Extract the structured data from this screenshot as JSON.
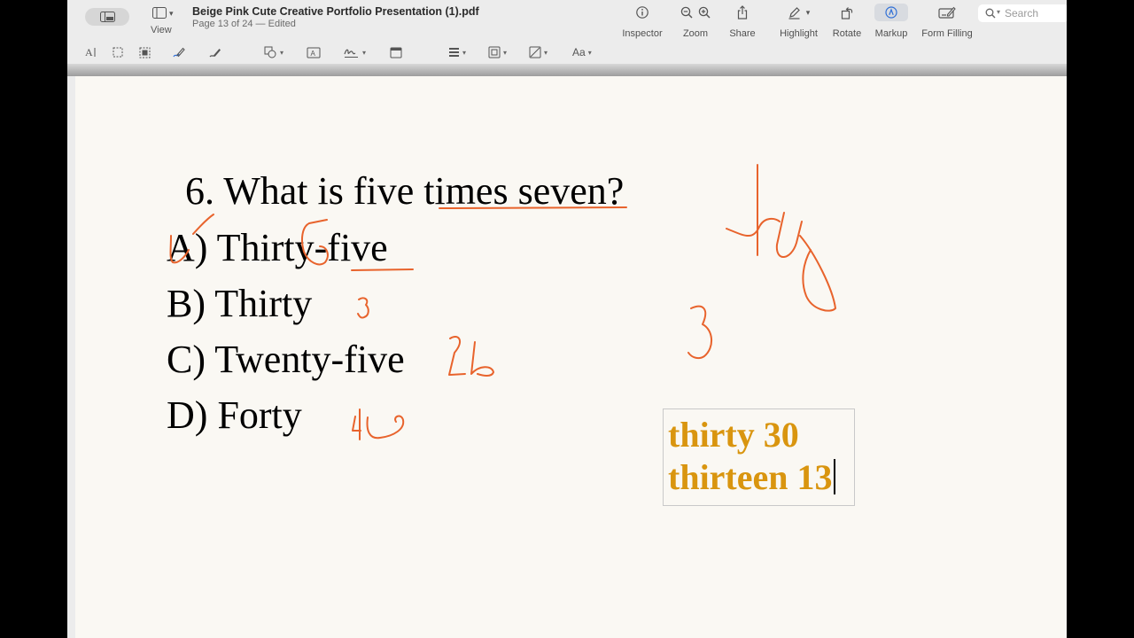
{
  "window": {
    "title": "Beige Pink Cute Creative Portfolio Presentation (1).pdf",
    "subtitle": "Page 13 of 24 — Edited"
  },
  "toolbar": {
    "view_label": "View",
    "inspector_label": "Inspector",
    "zoom_label": "Zoom",
    "share_label": "Share",
    "highlight_label": "Highlight",
    "rotate_label": "Rotate",
    "markup_label": "Markup",
    "form_filling_label": "Form Filling",
    "search_placeholder": "Search",
    "accent_color": "#2f6fd6"
  },
  "markup_bar": {
    "font_style_label": "Aa",
    "tools": [
      "text-selection-icon",
      "rect-selection-icon",
      "instant-alpha-icon",
      "sketch-icon",
      "draw-icon",
      "shapes-icon",
      "text-box-icon",
      "signature-icon",
      "note-icon",
      "shape-style-icon",
      "border-color-icon",
      "fill-color-icon",
      "text-style-icon"
    ]
  },
  "page": {
    "question": "6. What is five times seven?",
    "options": [
      {
        "letter": "A)",
        "text": "Thirty-five"
      },
      {
        "letter": "B)",
        "text": "Thirty"
      },
      {
        "letter": "C)",
        "text": "Twenty-five"
      },
      {
        "letter": "D)",
        "text": "Forty"
      }
    ],
    "text_box_lines": [
      "thirty 30",
      "thirteen 13"
    ],
    "annotation_color": "#e8632c",
    "text_box_color": "#d9950f"
  }
}
